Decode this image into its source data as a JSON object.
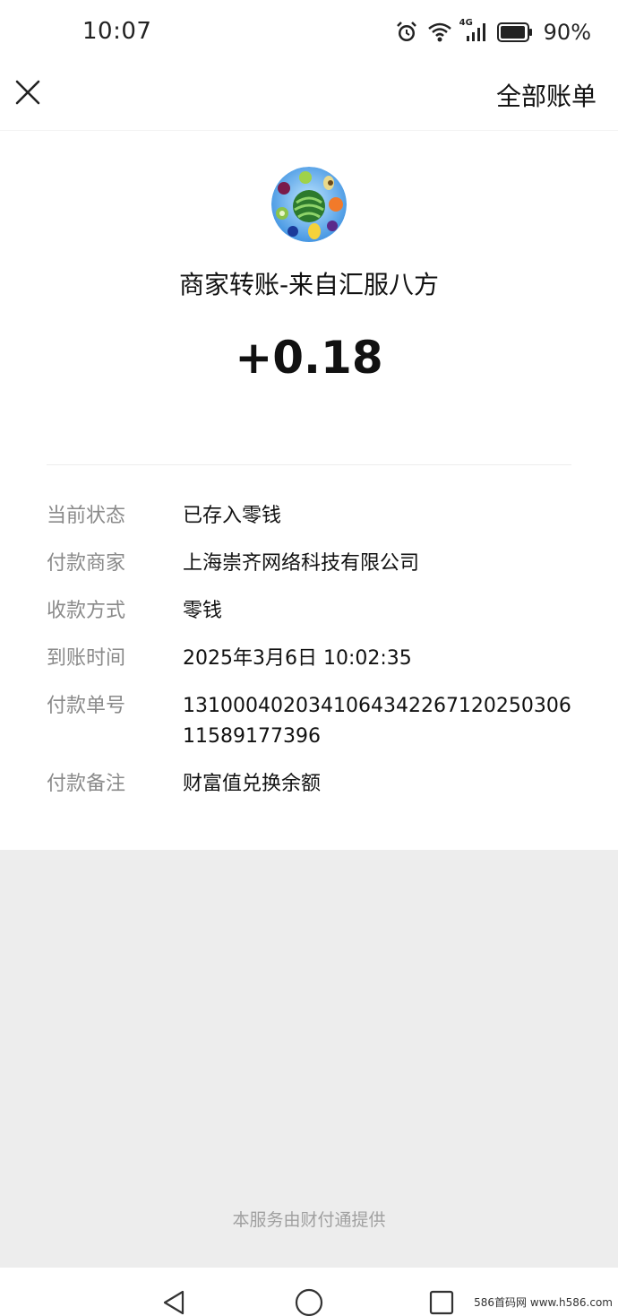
{
  "status_bar": {
    "time": "10:07",
    "network": "4G",
    "battery": "90%",
    "icons": [
      "alarm-icon",
      "wifi-icon",
      "signal-icon",
      "battery-icon"
    ]
  },
  "nav": {
    "close_icon": "close-icon",
    "all_bills": "全部账单"
  },
  "merchant": {
    "title": "商家转账-来自汇服八方",
    "amount": "+0.18",
    "avatar": "fruit-avatar"
  },
  "details": [
    {
      "label": "当前状态",
      "value": "已存入零钱"
    },
    {
      "label": "付款商家",
      "value": "上海崇齐网络科技有限公司"
    },
    {
      "label": "收款方式",
      "value": "零钱"
    },
    {
      "label": "到账时间",
      "value": "2025年3月6日 10:02:35"
    },
    {
      "label": "付款单号",
      "value": "131000402034106434226712025030611589177396"
    },
    {
      "label": "付款备注",
      "value": "财富值兑换余额"
    }
  ],
  "footer": "本服务由财付通提供",
  "watermark": "586首码网 www.h586.com",
  "colors": {
    "background": "#ededed",
    "card": "#ffffff",
    "label_gray": "#8a8a8a"
  }
}
